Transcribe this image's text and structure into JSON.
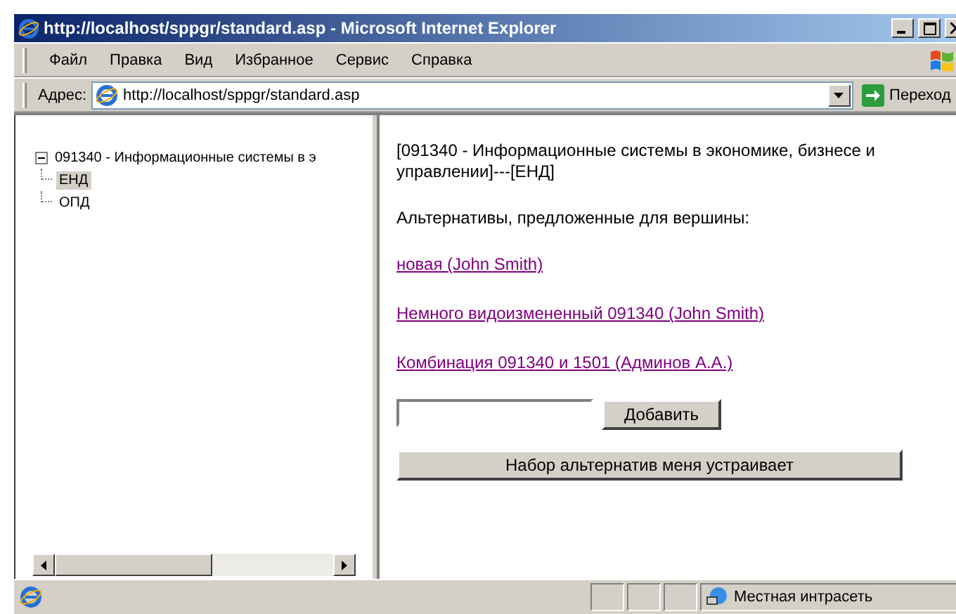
{
  "window": {
    "title": "http://localhost/sppgr/standard.asp - Microsoft Internet Explorer"
  },
  "menu": [
    "Файл",
    "Правка",
    "Вид",
    "Избранное",
    "Сервис",
    "Справка"
  ],
  "address_bar": {
    "label": "Адрес:",
    "url": "http://localhost/sppgr/standard.asp",
    "go_button": "Переход"
  },
  "tree": {
    "label": "091340 - Информационные системы в э",
    "expanded": true,
    "children": [
      {
        "label": "ЕНД",
        "selected": true
      },
      {
        "label": "ОПД",
        "selected": false
      }
    ]
  },
  "content": {
    "heading": "[091340 - Информационные системы в экономике, бизнесе и управлении]---[ЕНД]",
    "prompt": "Альтернативы, предложенные для вершины:",
    "links": [
      "новая (John Smith)",
      "Немного видоизмененный 091340 (John Smith)",
      "Комбинация 091340 и 1501 (Админов А.А.)"
    ],
    "add_button": "Добавить",
    "accept_button": "Набор альтернатив меня устраивает"
  },
  "status_bar": {
    "zone": "Местная интрасеть"
  }
}
